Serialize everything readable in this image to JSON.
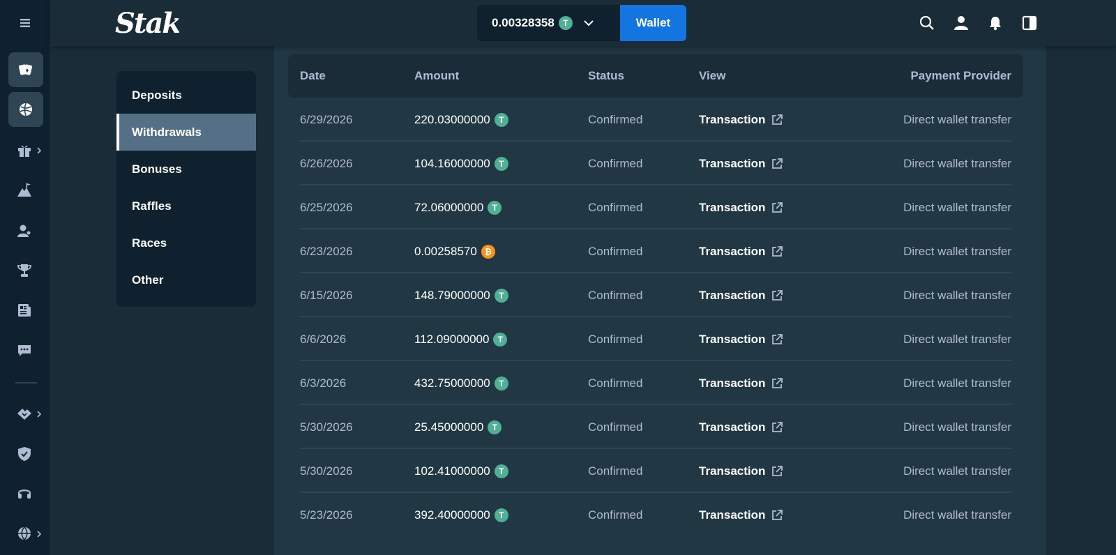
{
  "header": {
    "logo_text": "Stake",
    "balance": "0.00328358",
    "balance_currency_icon": "tether-coin-icon",
    "wallet_label": "Wallet"
  },
  "menu": {
    "items": [
      {
        "label": "Deposits",
        "active": false
      },
      {
        "label": "Withdrawals",
        "active": true
      },
      {
        "label": "Bonuses",
        "active": false
      },
      {
        "label": "Raffles",
        "active": false
      },
      {
        "label": "Races",
        "active": false
      },
      {
        "label": "Other",
        "active": false
      }
    ]
  },
  "table": {
    "headers": {
      "date": "Date",
      "amount": "Amount",
      "status": "Status",
      "view": "View",
      "provider": "Payment Provider"
    },
    "rows": [
      {
        "date": "6/29/2026",
        "amount": "220.03000000",
        "coin": "T",
        "status": "Confirmed",
        "view": "Transaction",
        "provider": "Direct wallet transfer"
      },
      {
        "date": "6/26/2026",
        "amount": "104.16000000",
        "coin": "T",
        "status": "Confirmed",
        "view": "Transaction",
        "provider": "Direct wallet transfer"
      },
      {
        "date": "6/25/2026",
        "amount": "72.06000000",
        "coin": "T",
        "status": "Confirmed",
        "view": "Transaction",
        "provider": "Direct wallet transfer"
      },
      {
        "date": "6/23/2026",
        "amount": "0.00258570",
        "coin": "B",
        "status": "Confirmed",
        "view": "Transaction",
        "provider": "Direct wallet transfer"
      },
      {
        "date": "6/15/2026",
        "amount": "148.79000000",
        "coin": "T",
        "status": "Confirmed",
        "view": "Transaction",
        "provider": "Direct wallet transfer"
      },
      {
        "date": "6/6/2026",
        "amount": "112.09000000",
        "coin": "T",
        "status": "Confirmed",
        "view": "Transaction",
        "provider": "Direct wallet transfer"
      },
      {
        "date": "6/3/2026",
        "amount": "432.75000000",
        "coin": "T",
        "status": "Confirmed",
        "view": "Transaction",
        "provider": "Direct wallet transfer"
      },
      {
        "date": "5/30/2026",
        "amount": "25.45000000",
        "coin": "T",
        "status": "Confirmed",
        "view": "Transaction",
        "provider": "Direct wallet transfer"
      },
      {
        "date": "5/30/2026",
        "amount": "102.41000000",
        "coin": "T",
        "status": "Confirmed",
        "view": "Transaction",
        "provider": "Direct wallet transfer"
      },
      {
        "date": "5/23/2026",
        "amount": "392.40000000",
        "coin": "T",
        "status": "Confirmed",
        "view": "Transaction",
        "provider": "Direct wallet transfer"
      }
    ]
  },
  "colors": {
    "background": "#1a2c38",
    "rail": "#0f212e",
    "panel": "#213743",
    "accent_blue": "#1475e1",
    "tether": "#50af95",
    "bitcoin": "#f7931a",
    "muted_text": "#b1bad3"
  },
  "icons": {
    "rail": [
      "menu-icon",
      "casino-cards-icon",
      "sports-ball-icon",
      "gift-icon",
      "mountain-flag-icon",
      "affiliate-user-icon",
      "trophy-icon",
      "news-icon",
      "chat-icon",
      "sponsorship-handshake-icon",
      "shield-check-icon",
      "support-headset-icon",
      "globe-icon"
    ],
    "header": [
      "search-icon",
      "user-icon",
      "bell-icon",
      "sidebar-toggle-icon"
    ]
  }
}
